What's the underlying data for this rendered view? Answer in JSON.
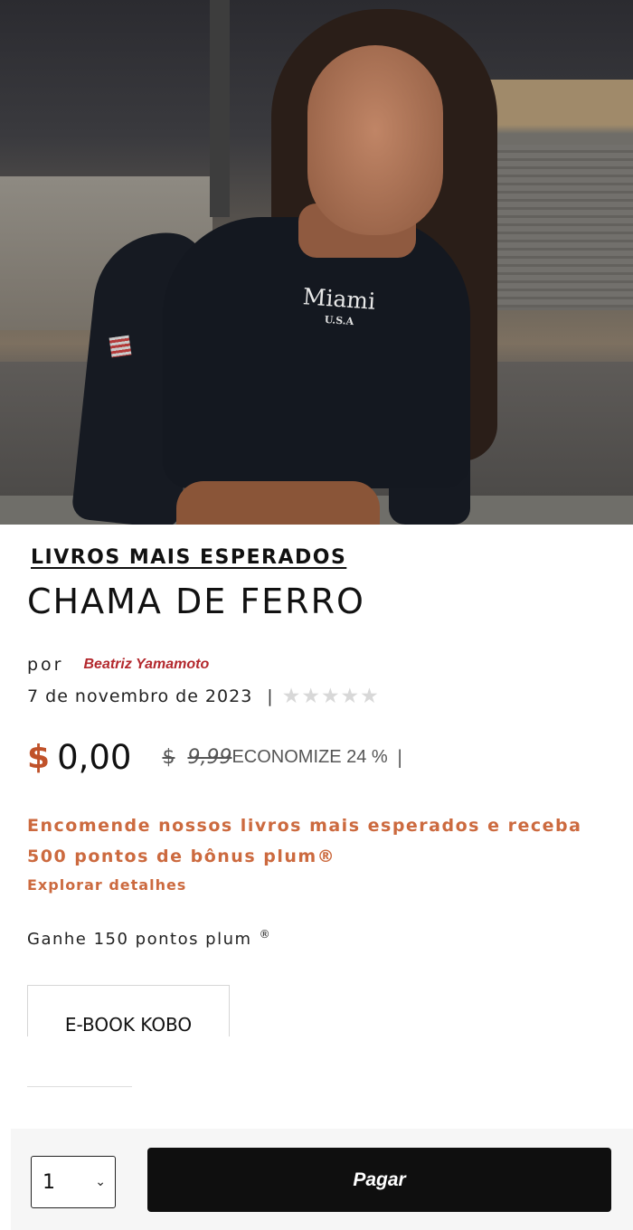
{
  "hero": {
    "shirt_text": "Miami",
    "shirt_subtext": "U.S.A"
  },
  "product": {
    "category_label": "LIVROS MAIS ESPERADOS",
    "title": "CHAMA DE FERRO",
    "by_label": "por",
    "author": "Beatriz Yamamoto",
    "release_date": "7 de novembro de 2023",
    "separator": "|",
    "rating_stars": "★★★★★",
    "rating_value": 0
  },
  "price": {
    "currency": "$",
    "current": "0,00",
    "original_currency": "$",
    "original": "9,99",
    "savings": "ECONOMIZE 24 %",
    "separator": "|",
    "accent_color": "#c0522a"
  },
  "promo": {
    "text": "Encomende nossos livros mais esperados e receba 500 pontos de bônus plum®",
    "link_label": "Explorar detalhes",
    "color": "#cc6a3f"
  },
  "points": {
    "text": "Ganhe 150 pontos plum",
    "mark": "®"
  },
  "format": {
    "selected": "E-BOOK KOBO"
  },
  "purchase": {
    "quantity": "1",
    "pay_label": "Pagar"
  }
}
